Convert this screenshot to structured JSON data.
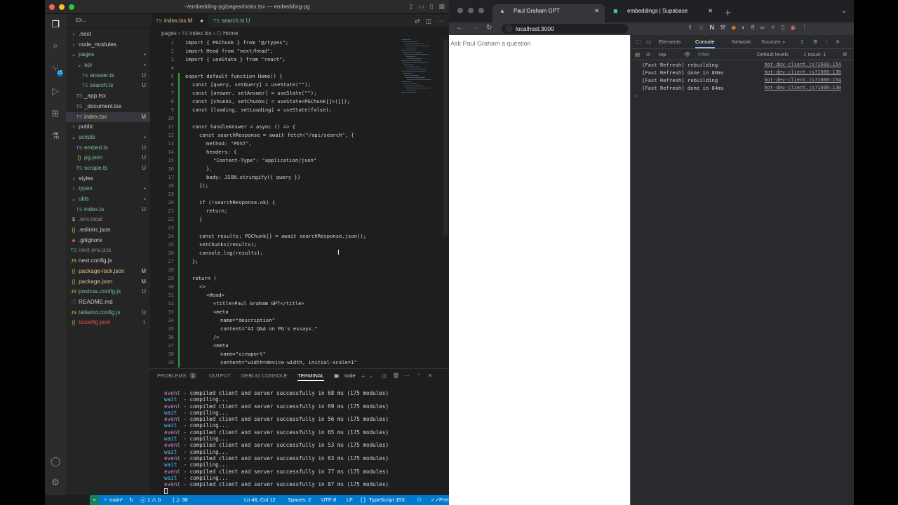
{
  "vscode": {
    "title": "~/embedding-pg/pages/index.tsx — embedding-pg",
    "explorer_label": "EX...",
    "tree": [
      {
        "name": ".next",
        "type": "folder",
        "depth": 0,
        "open": false,
        "status": ""
      },
      {
        "name": "node_modules",
        "type": "folder",
        "depth": 0,
        "open": false,
        "status": ""
      },
      {
        "name": "pages",
        "type": "folder",
        "depth": 0,
        "open": true,
        "status": "",
        "color": "#73c991"
      },
      {
        "name": "api",
        "type": "folder",
        "depth": 1,
        "open": true,
        "status": "",
        "color": "#73c991"
      },
      {
        "name": "answer.ts",
        "type": "ts",
        "depth": 2,
        "status": "U",
        "color": "#73c991"
      },
      {
        "name": "search.ts",
        "type": "ts",
        "depth": 2,
        "status": "U",
        "color": "#73c991"
      },
      {
        "name": "_app.tsx",
        "type": "ts",
        "depth": 1,
        "status": ""
      },
      {
        "name": "_document.tsx",
        "type": "ts",
        "depth": 1,
        "status": ""
      },
      {
        "name": "index.tsx",
        "type": "ts",
        "depth": 1,
        "status": "M",
        "color": "#e2c08d",
        "selected": true
      },
      {
        "name": "public",
        "type": "folder",
        "depth": 0,
        "open": false,
        "status": ""
      },
      {
        "name": "scripts",
        "type": "folder",
        "depth": 0,
        "open": true,
        "status": "",
        "color": "#73c991"
      },
      {
        "name": "embed.ts",
        "type": "ts",
        "depth": 1,
        "status": "U",
        "color": "#73c991"
      },
      {
        "name": "pg.json",
        "type": "json",
        "depth": 1,
        "status": "U",
        "color": "#73c991"
      },
      {
        "name": "scrape.ts",
        "type": "ts",
        "depth": 1,
        "status": "U",
        "color": "#73c991"
      },
      {
        "name": "styles",
        "type": "folder",
        "depth": 0,
        "open": false,
        "status": ""
      },
      {
        "name": "types",
        "type": "folder",
        "depth": 0,
        "open": false,
        "status": "",
        "color": "#73c991"
      },
      {
        "name": "utils",
        "type": "folder",
        "depth": 0,
        "open": true,
        "status": "",
        "color": "#73c991"
      },
      {
        "name": "index.ts",
        "type": "ts",
        "depth": 1,
        "status": "U",
        "color": "#73c991"
      },
      {
        "name": ".env.local",
        "type": "env",
        "depth": 0,
        "status": "",
        "color": "#8b8b8b"
      },
      {
        "name": ".eslintrc.json",
        "type": "json",
        "depth": 0,
        "status": ""
      },
      {
        "name": ".gitignore",
        "type": "git",
        "depth": 0,
        "status": ""
      },
      {
        "name": "next-env.d.ts",
        "type": "ts",
        "depth": 0,
        "status": "",
        "color": "#8b8b8b"
      },
      {
        "name": "next.config.js",
        "type": "js",
        "depth": 0,
        "status": ""
      },
      {
        "name": "package-lock.json",
        "type": "json",
        "depth": 0,
        "status": "M",
        "color": "#e2c08d"
      },
      {
        "name": "package.json",
        "type": "json",
        "depth": 0,
        "status": "M",
        "color": "#e2c08d"
      },
      {
        "name": "postcss.config.js",
        "type": "js",
        "depth": 0,
        "status": "U",
        "color": "#73c991"
      },
      {
        "name": "README.md",
        "type": "md",
        "depth": 0,
        "status": ""
      },
      {
        "name": "tailwind.config.js",
        "type": "js",
        "depth": 0,
        "status": "U",
        "color": "#73c991"
      },
      {
        "name": "tsconfig.json",
        "type": "json",
        "depth": 0,
        "status": "1",
        "color": "#f14c4c"
      }
    ],
    "tabs": [
      {
        "label": "index.tsx",
        "status": "M",
        "active": true
      },
      {
        "label": "search.ts",
        "status": "U",
        "active": false
      }
    ],
    "breadcrumb": {
      "folder": "pages",
      "file": "index.tsx",
      "symbol": "Home"
    },
    "code_lines": [
      {
        "n": "1",
        "indent": 0,
        "text": "import { PGChunk } from \"@/types\";"
      },
      {
        "n": "2",
        "indent": 0,
        "text": "import Head from \"next/head\";"
      },
      {
        "n": "3",
        "indent": 0,
        "text": "import { useState } from \"react\";"
      },
      {
        "n": "4",
        "indent": 0,
        "text": ""
      },
      {
        "n": "5",
        "indent": 0,
        "text": "export default function Home() {"
      },
      {
        "n": "6",
        "indent": 1,
        "text": "const [query, setQuery] = useState(\"\");"
      },
      {
        "n": "7",
        "indent": 1,
        "text": "const [answer, setAnswer] = useState(\"\");"
      },
      {
        "n": "8",
        "indent": 1,
        "text": "const [chunks, setChunks] = useState<PGChunk[]>([]);"
      },
      {
        "n": "9",
        "indent": 1,
        "text": "const [loading, setLoading] = useState(false);"
      },
      {
        "n": "10",
        "indent": 0,
        "text": ""
      },
      {
        "n": "11",
        "indent": 1,
        "text": "const handleAnswer = async () => {"
      },
      {
        "n": "12",
        "indent": 2,
        "text": "const searchResponse = await fetch(\"/api/search\", {"
      },
      {
        "n": "13",
        "indent": 3,
        "text": "method: \"POST\","
      },
      {
        "n": "14",
        "indent": 3,
        "text": "headers: {"
      },
      {
        "n": "15",
        "indent": 4,
        "text": "\"Content-Type\": \"application/json\""
      },
      {
        "n": "16",
        "indent": 3,
        "text": "},"
      },
      {
        "n": "17",
        "indent": 3,
        "text": "body: JSON.stringify({ query })"
      },
      {
        "n": "18",
        "indent": 2,
        "text": "});"
      },
      {
        "n": "19",
        "indent": 0,
        "text": ""
      },
      {
        "n": "20",
        "indent": 2,
        "text": "if (!searchResponse.ok) {"
      },
      {
        "n": "21",
        "indent": 3,
        "text": "return;"
      },
      {
        "n": "22",
        "indent": 2,
        "text": "}"
      },
      {
        "n": "23",
        "indent": 0,
        "text": ""
      },
      {
        "n": "24",
        "indent": 2,
        "text": "const results: PGChunk[] = await searchResponse.json();"
      },
      {
        "n": "25",
        "indent": 2,
        "text": "setChunks(results);"
      },
      {
        "n": "26",
        "indent": 2,
        "text": "console.log(results);"
      },
      {
        "n": "27",
        "indent": 1,
        "text": "};"
      },
      {
        "n": "28",
        "indent": 0,
        "text": ""
      },
      {
        "n": "29",
        "indent": 1,
        "text": "return ("
      },
      {
        "n": "30",
        "indent": 2,
        "text": "<>"
      },
      {
        "n": "31",
        "indent": 3,
        "text": "<Head>"
      },
      {
        "n": "32",
        "indent": 4,
        "text": "<title>Paul Graham GPT</title>"
      },
      {
        "n": "33",
        "indent": 4,
        "text": "<meta"
      },
      {
        "n": "34",
        "indent": 5,
        "text": "name=\"description\""
      },
      {
        "n": "35",
        "indent": 5,
        "text": "content=\"AI Q&A on PG's essays.\""
      },
      {
        "n": "36",
        "indent": 4,
        "text": "/>"
      },
      {
        "n": "37",
        "indent": 4,
        "text": "<meta"
      },
      {
        "n": "38",
        "indent": 5,
        "text": "name=\"viewport\""
      },
      {
        "n": "39",
        "indent": 5,
        "text": "content=\"width=device-width, initial-scale=1\""
      }
    ],
    "panel": {
      "tabs": [
        "PROBLEMS",
        "1",
        "OUTPUT",
        "DEBUG CONSOLE",
        "TERMINAL"
      ],
      "shell": "node",
      "terminal_lines": [
        {
          "kind": "event",
          "label": "event",
          "text": " - compiled client and server successfully in 68 ms (175 modules)"
        },
        {
          "kind": "wait",
          "label": "wait",
          "text": "  - compiling..."
        },
        {
          "kind": "event",
          "label": "event",
          "text": " - compiled client and server successfully in 69 ms (175 modules)"
        },
        {
          "kind": "wait",
          "label": "wait",
          "text": "  - compiling..."
        },
        {
          "kind": "event",
          "label": "event",
          "text": " - compiled client and server successfully in 56 ms (175 modules)"
        },
        {
          "kind": "wait",
          "label": "wait",
          "text": "  - compiling..."
        },
        {
          "kind": "event",
          "label": "event",
          "text": " - compiled client and server successfully in 65 ms (175 modules)"
        },
        {
          "kind": "wait",
          "label": "wait",
          "text": "  - compiling..."
        },
        {
          "kind": "event",
          "label": "event",
          "text": " - compiled client and server successfully in 53 ms (175 modules)"
        },
        {
          "kind": "wait",
          "label": "wait",
          "text": "  - compiling..."
        },
        {
          "kind": "event",
          "label": "event",
          "text": " - compiled client and server successfully in 63 ms (175 modules)"
        },
        {
          "kind": "wait",
          "label": "wait",
          "text": "  - compiling..."
        },
        {
          "kind": "event",
          "label": "event",
          "text": " - compiled client and server successfully in 77 ms (175 modules)"
        },
        {
          "kind": "wait",
          "label": "wait",
          "text": "  - compiling..."
        },
        {
          "kind": "event",
          "label": "event",
          "text": " - compiled client and server successfully in 87 ms (175 modules)"
        }
      ]
    },
    "status": {
      "branch": "main*",
      "problems": "1 ⚠ 0",
      "extra": "{..}: 38",
      "position": "Ln 46, Col 12",
      "spaces": "Spaces: 2",
      "encoding": "UTF-8",
      "eol": "LF",
      "language": "TypeScript JSX",
      "formatter": "Prettier"
    }
  },
  "chrome": {
    "tabs": [
      {
        "label": "Paul Graham GPT",
        "active": true
      },
      {
        "label": "embeddings | Supabase",
        "active": false
      }
    ],
    "url": "localhost:3000",
    "page_input_placeholder": "Ask Paul Graham a question",
    "devtools": {
      "tabs": [
        "Elements",
        "Console",
        "Network",
        "Sources"
      ],
      "active_tab": "Console",
      "context": "top",
      "filter_placeholder": "Filter",
      "levels": "Default levels",
      "issues": "1 Issue: 1",
      "badge": "1",
      "messages": [
        {
          "text": "[Fast Refresh] rebuilding",
          "source": "hot-dev-client.js?1600:154"
        },
        {
          "text": "[Fast Refresh] done in 80ms",
          "source": "hot-dev-client.js?1600:130"
        },
        {
          "text": "[Fast Refresh] rebuilding",
          "source": "hot-dev-client.js?1600:154"
        },
        {
          "text": "[Fast Refresh] done in 84ms",
          "source": "hot-dev-client.js?1600:130"
        }
      ]
    }
  },
  "colors": {
    "accent": "#007acc",
    "added": "#73c991",
    "modified": "#e2c08d",
    "error": "#f14c4c"
  }
}
